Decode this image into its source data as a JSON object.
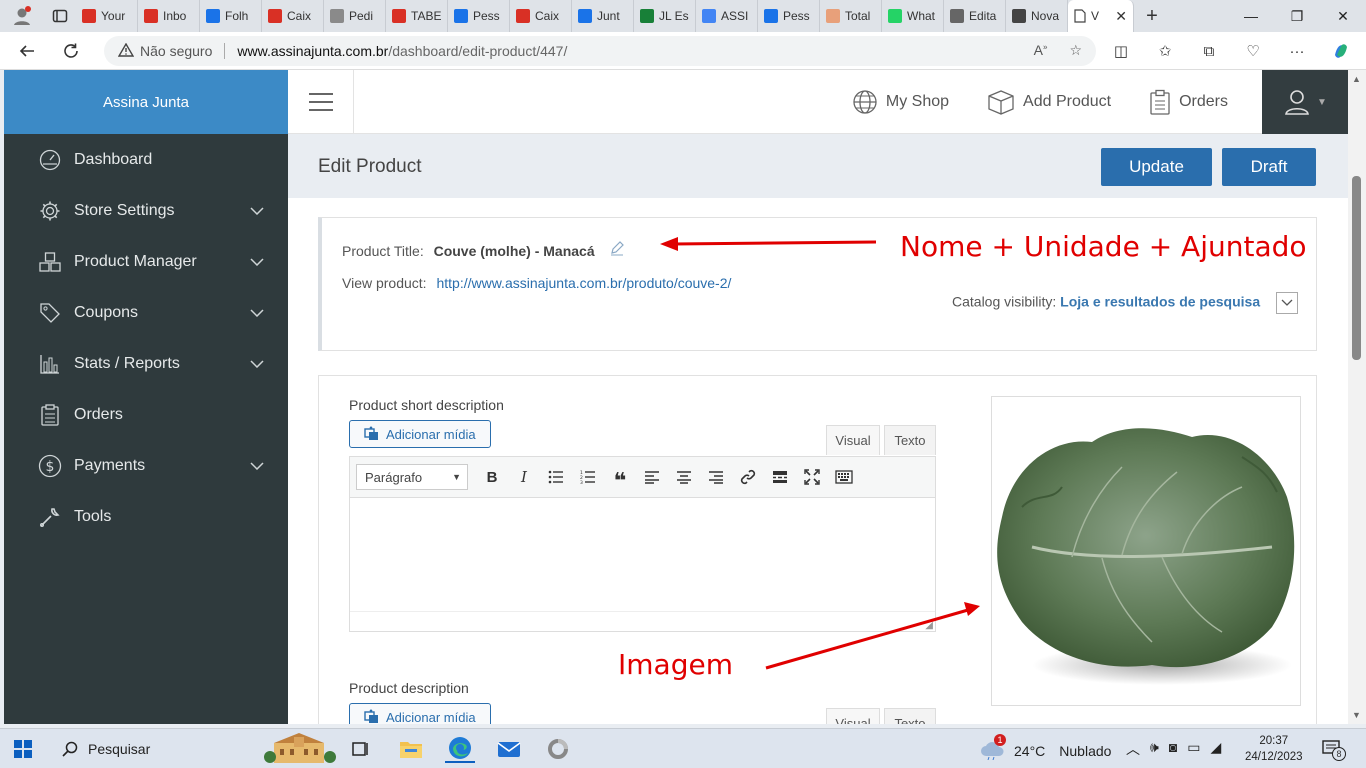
{
  "browser": {
    "tabs": [
      {
        "label": "Your",
        "color": "#d93025"
      },
      {
        "label": "Inbo",
        "color": "#d93025"
      },
      {
        "label": "Folh",
        "color": "#1a73e8"
      },
      {
        "label": "Caix",
        "color": "#d93025"
      },
      {
        "label": "Pedi",
        "color": "#8a8a8a"
      },
      {
        "label": "TABE",
        "color": "#d93025"
      },
      {
        "label": "Pess",
        "color": "#1a73e8"
      },
      {
        "label": "Caix",
        "color": "#d93025"
      },
      {
        "label": "Junt",
        "color": "#1a73e8"
      },
      {
        "label": "JL Es",
        "color": "#188038"
      },
      {
        "label": "ASSI",
        "color": "#4285f4"
      },
      {
        "label": "Pess",
        "color": "#1a73e8"
      },
      {
        "label": "Total",
        "color": "#e8a07a"
      },
      {
        "label": "What",
        "color": "#25d366"
      },
      {
        "label": "Edita",
        "color": "#666666"
      },
      {
        "label": "Nova",
        "color": "#444444"
      }
    ],
    "active_tab_label": "V",
    "security_label": "Não seguro",
    "url_host": "www.assinajunta.com.br",
    "url_path": "/dashboard/edit-product/447/"
  },
  "sidebar": {
    "brand": "Assina Junta",
    "items": [
      {
        "label": "Dashboard",
        "icon": "dashboard-icon",
        "has_submenu": false
      },
      {
        "label": "Store Settings",
        "icon": "gear-icon",
        "has_submenu": true
      },
      {
        "label": "Product Manager",
        "icon": "cubes-icon",
        "has_submenu": true
      },
      {
        "label": "Coupons",
        "icon": "tag-icon",
        "has_submenu": true
      },
      {
        "label": "Stats / Reports",
        "icon": "bar-chart-icon",
        "has_submenu": true
      },
      {
        "label": "Orders",
        "icon": "clipboard-icon",
        "has_submenu": false
      },
      {
        "label": "Payments",
        "icon": "dollar-icon",
        "has_submenu": true
      },
      {
        "label": "Tools",
        "icon": "wrench-icon",
        "has_submenu": false
      }
    ]
  },
  "topbar": {
    "my_shop": "My Shop",
    "add_product": "Add Product",
    "orders": "Orders"
  },
  "page": {
    "title": "Edit Product",
    "update_label": "Update",
    "draft_label": "Draft"
  },
  "product": {
    "title_label": "Product Title:",
    "title_value": "Couve (molhe) - Manacá",
    "view_label": "View product:",
    "view_url": "http://www.assinajunta.com.br/produto/couve-2/",
    "catalog_label": "Catalog visibility:",
    "catalog_value": "Loja e resultados de pesquisa"
  },
  "editor": {
    "short_desc_label": "Product short description",
    "desc_label": "Product description",
    "add_media": "Adicionar mídia",
    "tab_visual": "Visual",
    "tab_text": "Texto",
    "format_select": "Parágrafo"
  },
  "annotations": {
    "title_note": "Nome + Unidade + Ajuntado",
    "image_note": "Imagem",
    "color": "#e00000"
  },
  "taskbar": {
    "search_placeholder": "Pesquisar",
    "weather_temp": "24°C",
    "weather_desc": "Nublado",
    "weather_badge": "1",
    "time": "20:37",
    "date": "24/12/2023",
    "notif_count": "8"
  },
  "colors": {
    "brand": "#3c8ac6",
    "sidebar": "#2f3a3d",
    "primary_button": "#2a6ead"
  }
}
